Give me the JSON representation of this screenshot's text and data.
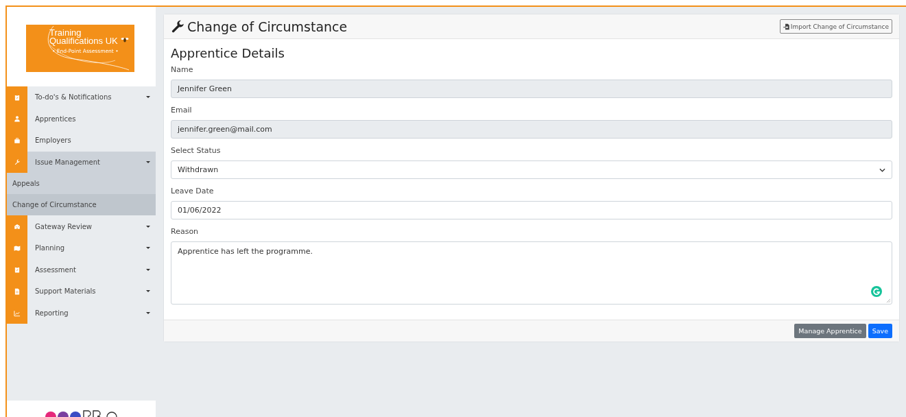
{
  "sidebar": {
    "logo": {
      "line_1": "Training",
      "line_2": "Qualifications UK",
      "tagline": "• End-Point Assessment •"
    },
    "items": [
      {
        "kind": "item",
        "label": "To-do's & Notifications",
        "has_caret": true,
        "selected": false
      },
      {
        "kind": "item",
        "label": "Apprentices",
        "has_caret": false,
        "selected": false
      },
      {
        "kind": "item",
        "label": "Employers",
        "has_caret": false,
        "selected": false
      },
      {
        "kind": "item",
        "label": "Issue Management",
        "has_caret": true,
        "selected": true
      },
      {
        "kind": "subitem",
        "label": "Appeals",
        "selected": false
      },
      {
        "kind": "subitem",
        "label": "Change of Circumstance",
        "selected": true
      },
      {
        "kind": "item",
        "label": "Gateway Review",
        "has_caret": true,
        "selected": false
      },
      {
        "kind": "item",
        "label": "Planning",
        "has_caret": true,
        "selected": false
      },
      {
        "kind": "item",
        "label": "Assessment",
        "has_caret": true,
        "selected": false
      },
      {
        "kind": "item",
        "label": "Support Materials",
        "has_caret": true,
        "selected": false
      },
      {
        "kind": "item",
        "label": "Reporting",
        "has_caret": true,
        "selected": false
      }
    ]
  },
  "card": {
    "title": "Change of Circumstance",
    "import_button": "Import Change of Circumstance",
    "section_title": "Apprentice Details",
    "fields": [
      {
        "kind": "readonly",
        "label": "Name",
        "value": "Jennifer Green"
      },
      {
        "kind": "readonly",
        "label": "Email",
        "value": "jennifer.green@mail.com"
      },
      {
        "kind": "select",
        "label": "Select Status",
        "value": "Withdrawn"
      },
      {
        "kind": "input",
        "label": "Leave Date",
        "value": "01/06/2022"
      },
      {
        "kind": "textarea",
        "label": "Reason",
        "value": "Apprentice has left the programme."
      }
    ],
    "buttons": [
      {
        "kind": "secondary",
        "label": "Manage Apprentice"
      },
      {
        "kind": "primary",
        "label": "Save"
      }
    ]
  }
}
